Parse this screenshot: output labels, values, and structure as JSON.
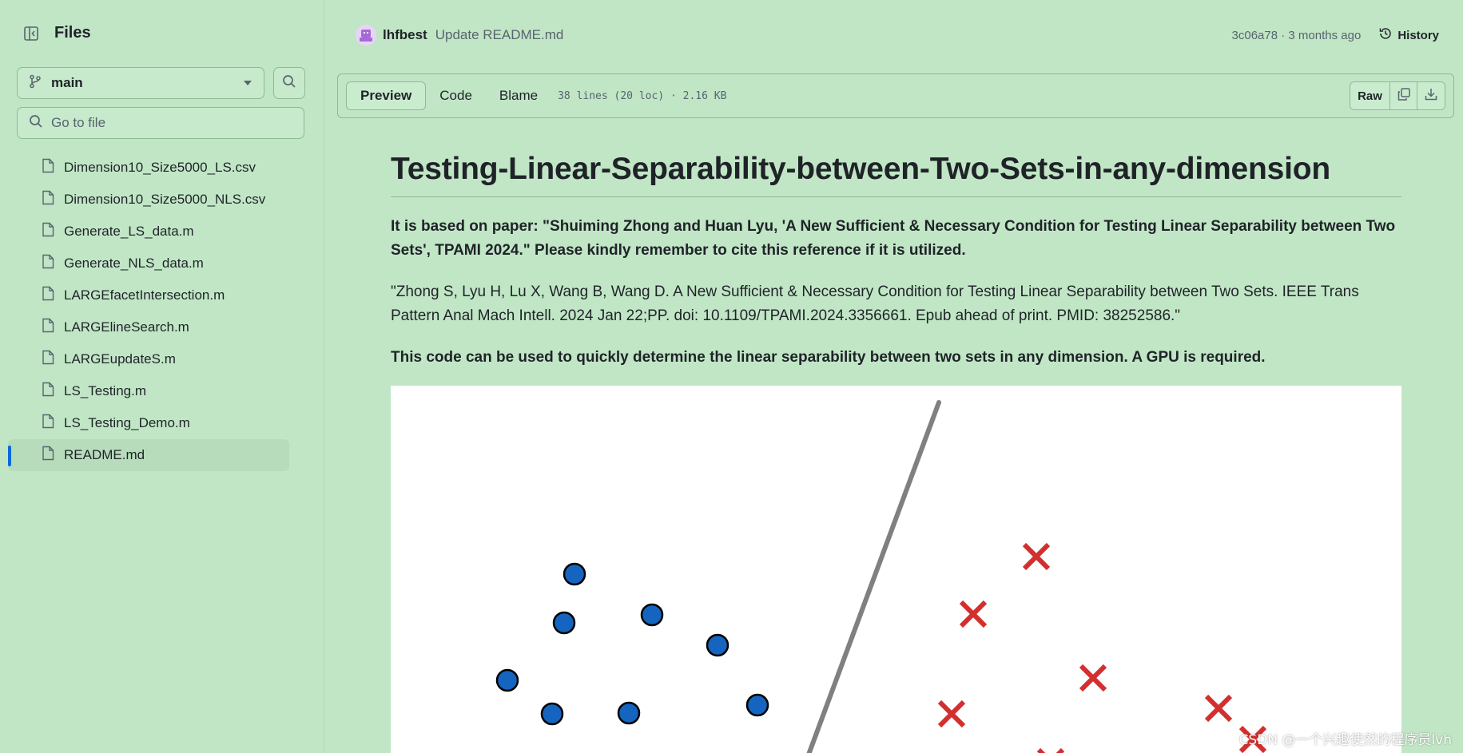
{
  "sidebar": {
    "title": "Files",
    "branch": "main",
    "goto_placeholder": "Go to file",
    "files": [
      "Dimension10_Size5000_LS.csv",
      "Dimension10_Size5000_NLS.csv",
      "Generate_LS_data.m",
      "Generate_NLS_data.m",
      "LARGEfacetIntersection.m",
      "LARGElineSearch.m",
      "LARGEupdateS.m",
      "LS_Testing.m",
      "LS_Testing_Demo.m",
      "README.md"
    ],
    "active_file": "README.md"
  },
  "commit": {
    "author": "lhfbest",
    "message": "Update README.md",
    "meta": "3c06a78 · 3 months ago",
    "history_label": "History"
  },
  "toolbar": {
    "preview_label": "Preview",
    "code_label": "Code",
    "blame_label": "Blame",
    "stats": "38 lines (20 loc) · 2.16 KB",
    "raw_label": "Raw"
  },
  "readme": {
    "title": "Testing-Linear-Separability-between-Two-Sets-in-any-dimension",
    "para1": "It is based on paper: \"Shuiming Zhong and Huan Lyu, 'A New Sufficient & Necessary Condition for Testing Linear Separability between Two Sets', TPAMI 2024.\" Please kindly remember to cite this reference if it is utilized.",
    "para2": "\"Zhong S, Lyu H, Lu X, Wang B, Wang D. A New Sufficient & Necessary Condition for Testing Linear Separability between Two Sets. IEEE Trans Pattern Anal Mach Intell. 2024 Jan 22;PP. doi: 10.1109/TPAMI.2024.3356661. Epub ahead of print. PMID: 38252586.\"",
    "para3": "This code can be used to quickly determine the linear separability between two sets in any dimension. A GPU is required."
  },
  "figure": {
    "circle_color": "#1565c0",
    "cross_color": "#d32f2f",
    "line_color": "#808080"
  },
  "watermark": "CSDN @一个兴趣使然的程序员lvh",
  "colors": {
    "background": "#c1e6c6",
    "accent": "#0969da"
  }
}
